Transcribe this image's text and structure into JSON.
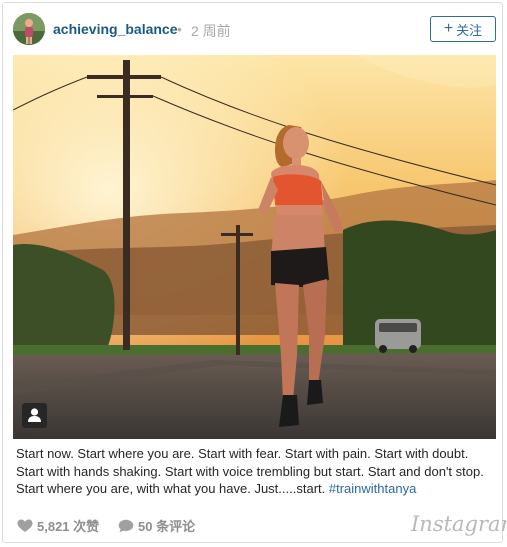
{
  "post": {
    "username": "achieving_balance",
    "separator": "•",
    "time_ago": "2 周前",
    "follow_label": "关注",
    "follow_plus": "+",
    "caption_text": "Start now. Start where you are. Start with fear. Start with pain. Start with doubt. Start with hands shaking. Start with voice trembling but start. Start and don't stop. Start where you are, with what you have. Just.....start.",
    "hashtag": "#trainwithtanya",
    "likes": "5,821 次赞",
    "comments": "50 条评论",
    "brand": "Instagram"
  },
  "icons": {
    "avatar": "avatar",
    "user_tag": "person-icon",
    "like": "heart-icon",
    "comment": "comment-bubble-icon"
  },
  "colors": {
    "username": "#1c5a86",
    "follow": "#2e6da4",
    "hashtag": "#2a6aa0",
    "meta": "#8f8f8f"
  }
}
